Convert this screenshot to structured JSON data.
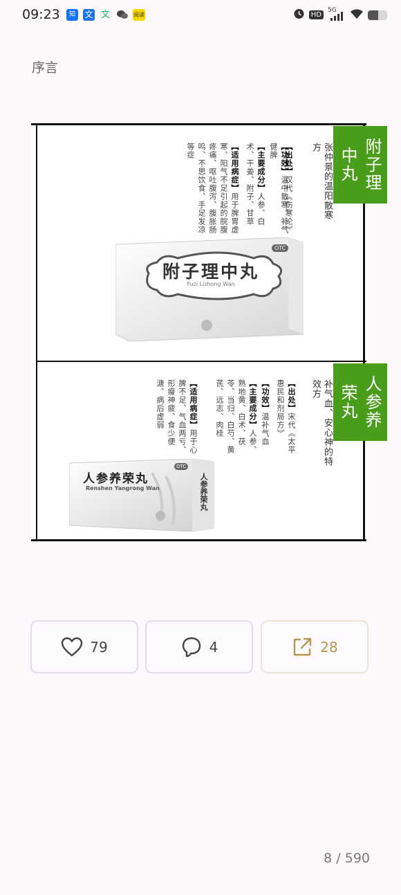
{
  "status_bar": {
    "time": "09:23",
    "apps": [
      {
        "name": "zhihu-icon",
        "label": "知乎",
        "color": "#1772f6"
      },
      {
        "name": "translate-icon",
        "label": "文",
        "color": "#1a73e8"
      },
      {
        "name": "wenku-icon",
        "label": "文",
        "color": "#19b955"
      },
      {
        "name": "wechat-icon",
        "label": "",
        "color": "#444444"
      },
      {
        "name": "yuedu-icon",
        "label": "阅读",
        "color": "#ffd600"
      }
    ],
    "network": "5G",
    "hd": "HD",
    "battery_level": 0.55
  },
  "page": {
    "title": "序言"
  },
  "article": {
    "section1": {
      "name": "附子理中丸",
      "subtitle": "张仲景的温阳散寒方",
      "source_label": "【出处】",
      "source": "汉代《伤寒论》",
      "effect_label": "【功效】",
      "effect": "温中散寒，补气健脾",
      "ingredients_label": "【主要成分】",
      "ingredients": "人参、白术、干姜、附子、甘草",
      "indications_label": "【适用病症】",
      "indications": "用于脾胃虚寒、阳气不足引起的脘腹疼痛、呕吐腹泻、腹胀肠鸣、不思饮食、手足发凉等症",
      "box_name": "附子理中丸",
      "box_pinyin": "Fuzi Lizhong Wan",
      "otc": "OTC"
    },
    "section2": {
      "name": "人参养荣丸",
      "subtitle": "补气血、安心神的特效方",
      "source_label": "【出处】",
      "source": "宋代《太平惠民和剂局方》",
      "effect_label": "【功效】",
      "effect": "温补气血",
      "ingredients_label": "【主要成分】",
      "ingredients": "人参、熟地黄、白术、茯苓、当归、白芍、黄芪、远志、肉桂",
      "indications_label": "【适用病症】",
      "indications": "用于心脾不足、气血两亏、形瘦神疲、食少便溏、病后虚弱",
      "box_name": "人参养荣丸",
      "box_pinyin": "Renshen Yangrong Wan",
      "otc": "OTC"
    }
  },
  "actions": {
    "like_count": "79",
    "comment_count": "4",
    "share_count": "28"
  },
  "pager": {
    "text": "8 / 590"
  },
  "colors": {
    "background": "#fcf8fc",
    "title_green": "#4a9d1b",
    "share_gold": "#b8964e"
  }
}
